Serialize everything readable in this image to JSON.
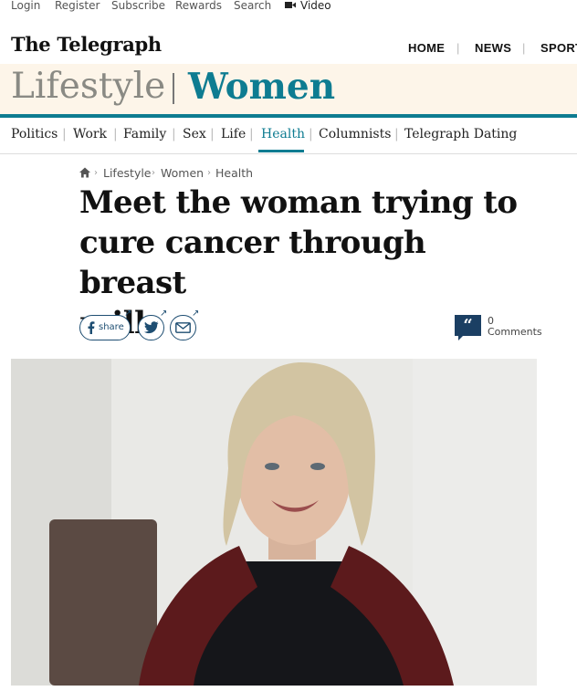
{
  "topbar": {
    "links": [
      "Login",
      "Register",
      "Subscribe",
      "Rewards",
      "Search"
    ],
    "video_label": "Video"
  },
  "masthead": {
    "logo": "The Telegraph",
    "nav": [
      "HOME",
      "NEWS",
      "SPORT"
    ]
  },
  "section": {
    "name": "Lifestyle",
    "subsection": "Women"
  },
  "subnav": {
    "items": [
      "Politics",
      "Work",
      "Family",
      "Sex",
      "Life",
      "Health",
      "Columnists",
      "Telegraph Dating"
    ],
    "active": "Health"
  },
  "breadcrumb": [
    "Lifestyle",
    "Women",
    "Health"
  ],
  "article": {
    "headline_lines": [
      "Meet the woman trying to",
      "cure cancer through breast",
      "milk"
    ]
  },
  "share": {
    "facebook_label": "share"
  },
  "comments": {
    "count": "0",
    "label": "Comments"
  },
  "colors": {
    "accent": "#0e7c91",
    "band": "#fdf5e9",
    "share_blue": "#1e4e72"
  }
}
